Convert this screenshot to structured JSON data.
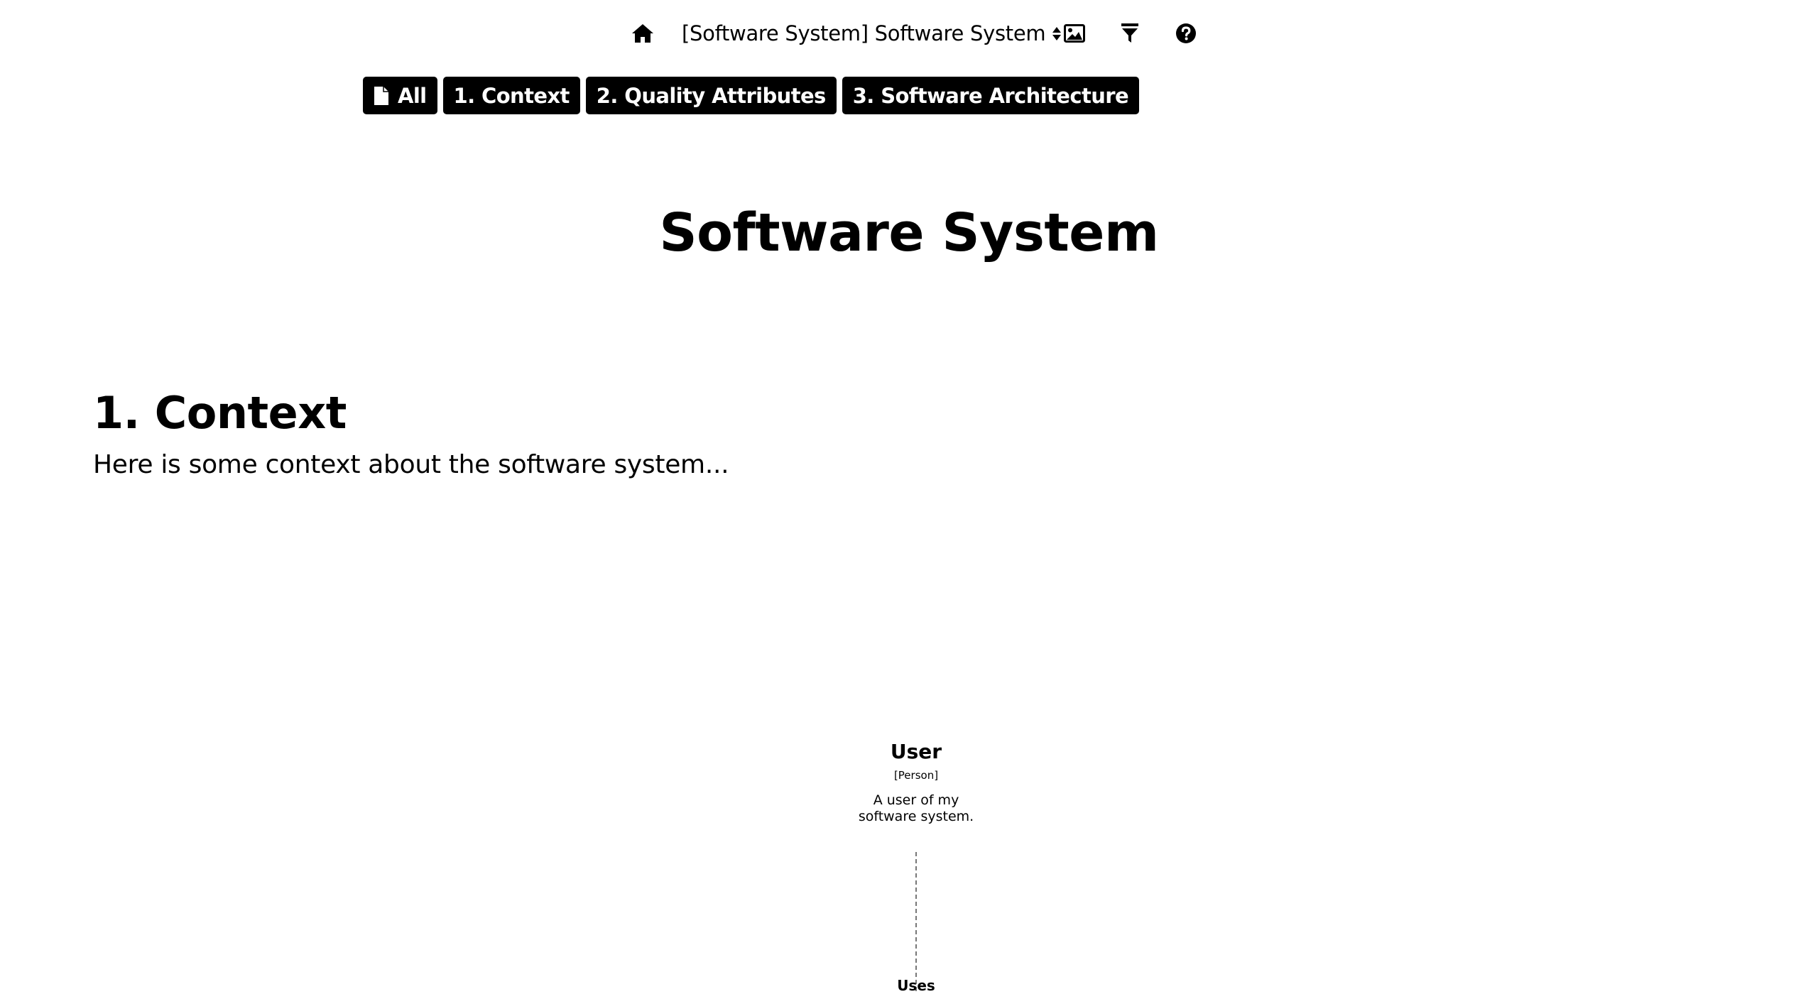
{
  "toolbar": {
    "icons": {
      "home": "home-icon",
      "image": "image-icon",
      "filter": "filter-icon",
      "help": "help-icon"
    },
    "selector_value": "[Software System] Software System"
  },
  "nav": {
    "buttons": [
      {
        "label": "All",
        "icon": "file-icon"
      },
      {
        "label": "1. Context"
      },
      {
        "label": "2. Quality Attributes"
      },
      {
        "label": "3. Software Architecture"
      }
    ]
  },
  "document": {
    "title": "Software System",
    "sections": [
      {
        "heading": "1. Context",
        "text": "Here is some context about the software system..."
      }
    ]
  },
  "diagram": {
    "person": {
      "name": "User",
      "type": "[Person]",
      "description": "A user of my software system."
    },
    "relationship": {
      "label": "Uses"
    }
  }
}
